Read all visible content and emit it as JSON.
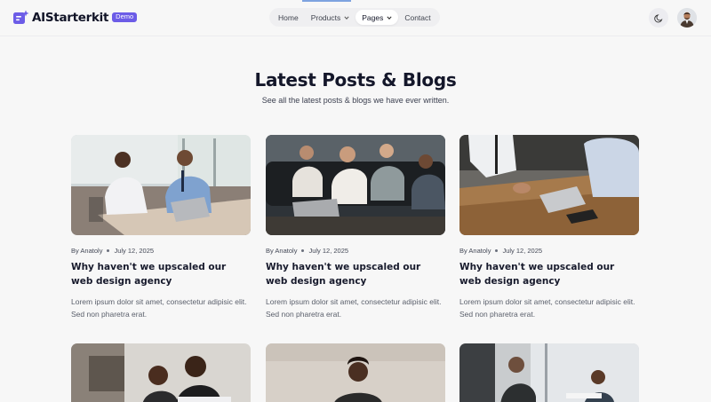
{
  "brand": {
    "name": "AIStarterkit",
    "badge": "Demo",
    "accent": "#6c5ce7"
  },
  "nav": {
    "items": [
      {
        "label": "Home",
        "dropdown": false,
        "active": false
      },
      {
        "label": "Products",
        "dropdown": true,
        "active": false
      },
      {
        "label": "Pages",
        "dropdown": true,
        "active": true
      },
      {
        "label": "Contact",
        "dropdown": false,
        "active": false
      }
    ],
    "theme_toggle_icon": "moon-icon",
    "avatar_icon": "user-avatar"
  },
  "section": {
    "title": "Latest Posts & Blogs",
    "subtitle": "See all the latest posts & blogs we have ever written."
  },
  "posts": [
    {
      "author": "By Anatoly",
      "date": "July 12, 2025",
      "title": "Why haven't we upscaled our web design agency",
      "excerpt": "Lorem ipsum dolor sit amet, consectetur adipisic elit. Sed non pharetra erat."
    },
    {
      "author": "By Anatoly",
      "date": "July 12, 2025",
      "title": "Why haven't we upscaled our web design agency",
      "excerpt": "Lorem ipsum dolor sit amet, consectetur adipisic elit. Sed non pharetra erat."
    },
    {
      "author": "By Anatoly",
      "date": "July 12, 2025",
      "title": "Why haven't we upscaled our web design agency",
      "excerpt": "Lorem ipsum dolor sit amet, consectetur adipisic elit. Sed non pharetra erat."
    }
  ]
}
